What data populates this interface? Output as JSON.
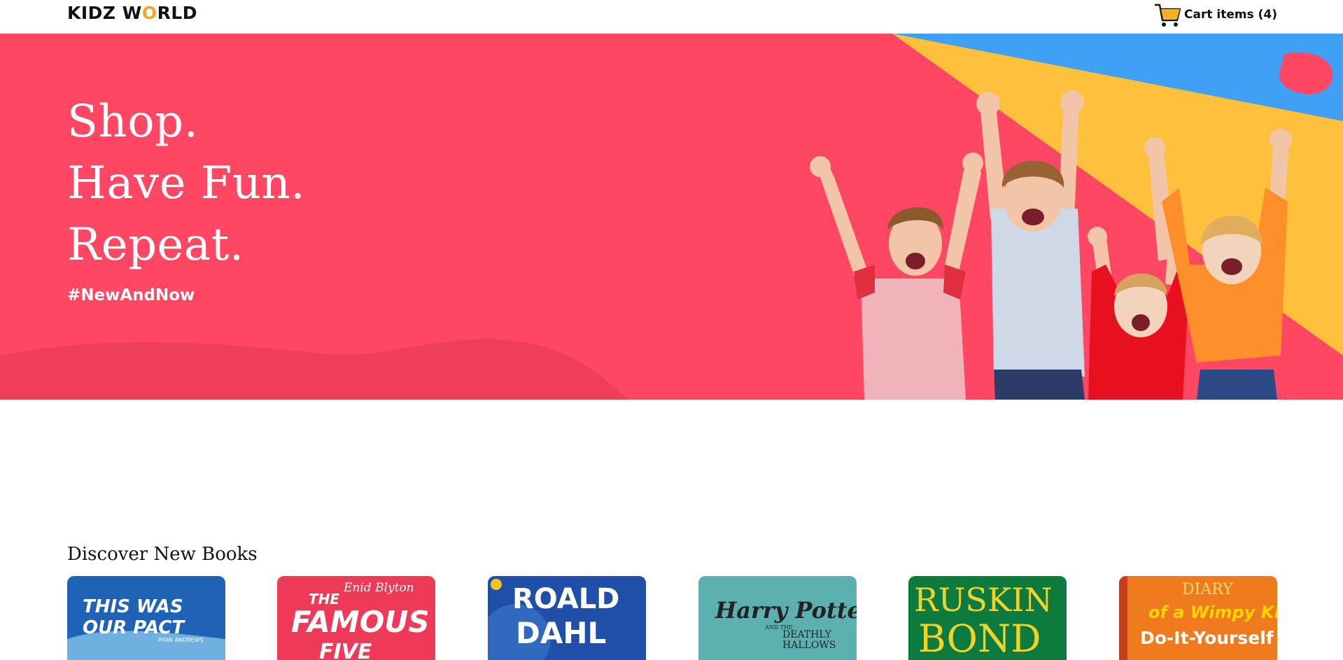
{
  "header": {
    "logo_text_left": "KIDZ W",
    "logo_text_o": "O",
    "logo_text_right": "RLD",
    "cart_label": "Cart items (4)",
    "cart_icon": "shopping-cart-icon"
  },
  "hero": {
    "headline": [
      "Shop.",
      "Have Fun.",
      "Repeat."
    ],
    "hashtag": "#NewAndNow",
    "colors": {
      "background": "#ff4763",
      "wave": "#ef3e58",
      "yellow": "#ffc13b",
      "blue": "#3fa0f5",
      "blob": "#ff4763"
    }
  },
  "books_section": {
    "title": "Discover New Books",
    "books": [
      {
        "cover_text_1": "THIS WAS",
        "cover_text_2": "OUR PACT",
        "author": "RYAN ANDREWS",
        "color": "#1f63b6"
      },
      {
        "cover_text_1": "THE",
        "cover_text_2": "FAMOUS",
        "cover_text_3": "FIVE",
        "author": "Enid Blyton",
        "color": "#ee3a58"
      },
      {
        "cover_text_1": "ROALD",
        "cover_text_2": "DAHL",
        "color": "#1f4fa8"
      },
      {
        "cover_text_1": "Harry Potter",
        "cover_text_2": "AND THE",
        "cover_text_3": "DEATHLY",
        "cover_text_4": "HALLOWS",
        "color": "#4aa8a8"
      },
      {
        "cover_text_1": "RUSKIN",
        "cover_text_2": "BOND",
        "color": "#0d7a3e"
      },
      {
        "cover_text_1": "DIARY",
        "cover_text_2": "of a Wimpy Kid",
        "cover_text_3": "Do-It-Yourself",
        "color": "#f07a1e"
      }
    ]
  }
}
